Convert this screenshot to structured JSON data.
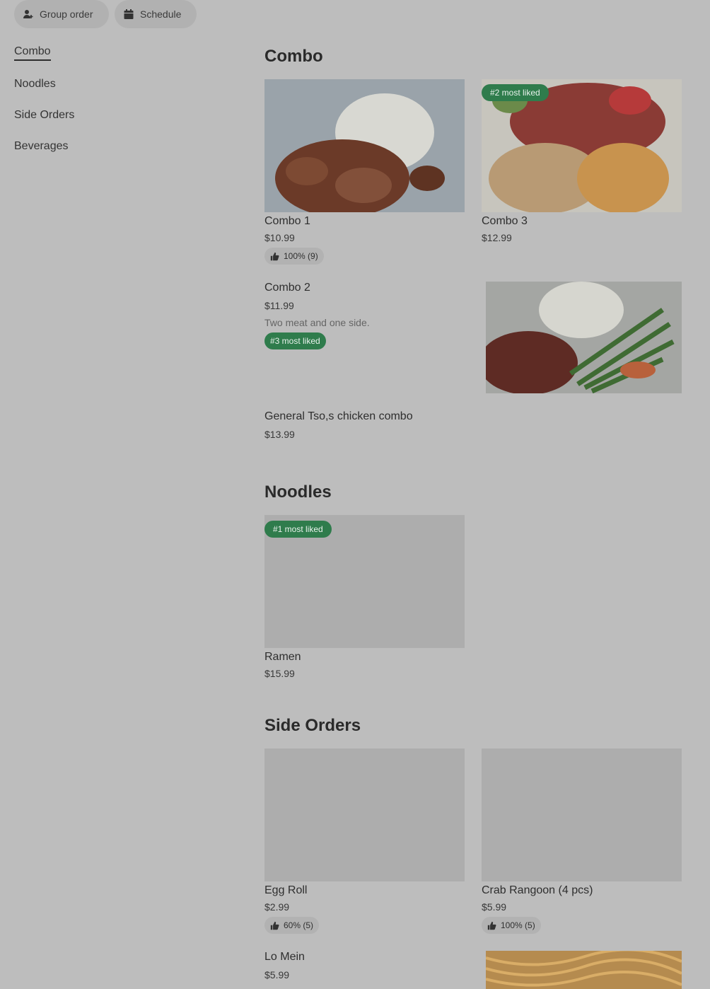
{
  "top_buttons": {
    "group_order": "Group order",
    "schedule": "Schedule"
  },
  "sidebar": {
    "items": [
      {
        "label": "Combo"
      },
      {
        "label": "Noodles"
      },
      {
        "label": "Side Orders"
      },
      {
        "label": "Beverages"
      }
    ]
  },
  "sections": {
    "combo": {
      "title": "Combo",
      "items": [
        {
          "name": "Combo 1",
          "price": "$10.99",
          "rating": "100% (9)"
        },
        {
          "name": "Combo 3",
          "price": "$12.99",
          "badge": "#2 most liked"
        },
        {
          "name": "Combo 2",
          "price": "$11.99",
          "description": "Two meat and one side.",
          "badge": "#3 most liked"
        },
        {
          "name": "General Tso,s chicken combo",
          "price": "$13.99"
        }
      ]
    },
    "noodles": {
      "title": "Noodles",
      "items": [
        {
          "name": "Ramen",
          "price": "$15.99",
          "badge": "#1 most liked"
        }
      ]
    },
    "side_orders": {
      "title": "Side Orders",
      "items": [
        {
          "name": "Egg Roll",
          "price": "$2.99",
          "rating": "60% (5)"
        },
        {
          "name": "Crab Rangoon (4 pcs)",
          "price": "$5.99",
          "rating": "100% (5)"
        },
        {
          "name": "Lo Mein",
          "price": "$5.99"
        }
      ]
    }
  },
  "colors": {
    "background": "#bdbdbd",
    "badge": "#2f7c4c",
    "pill": "#b1b1b1"
  }
}
